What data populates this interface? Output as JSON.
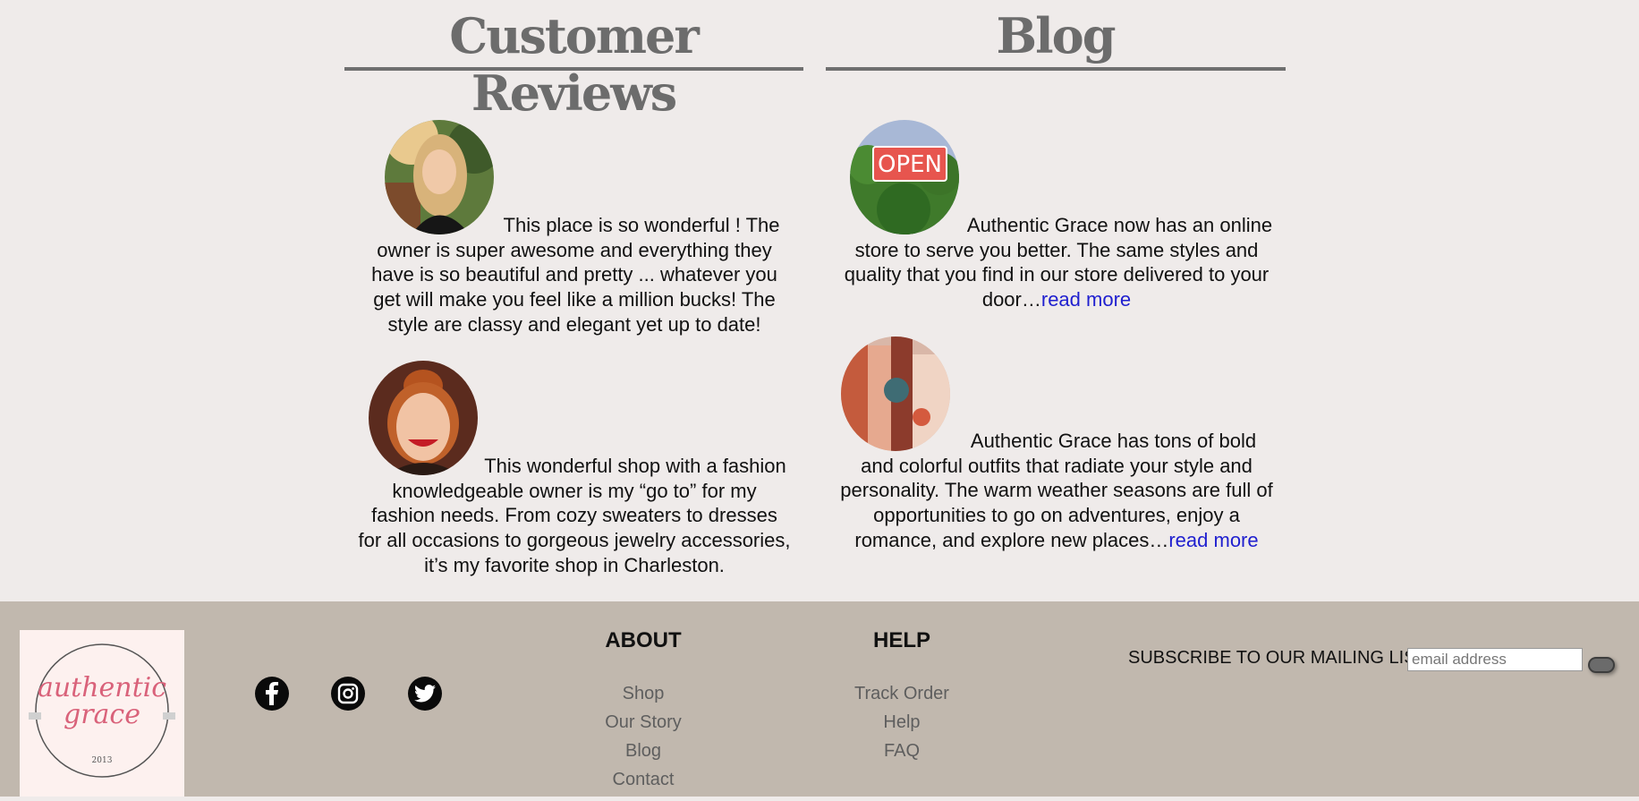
{
  "reviews": {
    "title": "Customer Reviews",
    "items": [
      {
        "text": "This place is so wonderful ! The owner is super awesome and everything they have is so beautiful and pretty ... whatever you get will make you feel like a million bucks! The style are classy and elegant yet up to date!"
      },
      {
        "text": "This wonderful shop with a fashion knowledgeable owner is my “go to” for my fashion needs. From cozy sweaters to dresses for all occasions to gorgeous jewelry accessories, it’s my favorite shop in Charleston."
      }
    ]
  },
  "blog": {
    "title": "Blog",
    "items": [
      {
        "text": "Authentic Grace now has an online store to serve you better. The same styles and quality that you find in our store delivered to your door…",
        "link": "read more"
      },
      {
        "text": "Authentic Grace has tons of bold and colorful outfits that radiate your style and personality. The warm weather seasons are full of opportunities to go on adventures, enjoy a romance, and explore new places…",
        "link": "read more"
      }
    ]
  },
  "footer": {
    "logo": {
      "line1": "authentic",
      "line2": "grace",
      "year": "2013"
    },
    "social": [
      "facebook-icon",
      "instagram-icon",
      "twitter-icon"
    ],
    "about": {
      "title": "ABOUT",
      "links": [
        "Shop",
        "Our Story",
        "Blog",
        "Contact"
      ]
    },
    "help": {
      "title": "HELP",
      "links": [
        "Track Order",
        "Help",
        "FAQ"
      ]
    },
    "subscribe": {
      "label": "SUBSCRIBE TO OUR MAILING LIST",
      "placeholder": "email address"
    }
  },
  "colors": {
    "page_bg": "#efebea",
    "footer_bg": "#c1b8ae",
    "heading": "#6c6c6c",
    "link": "#1f1fcf",
    "logo_pink": "#d9627a"
  }
}
